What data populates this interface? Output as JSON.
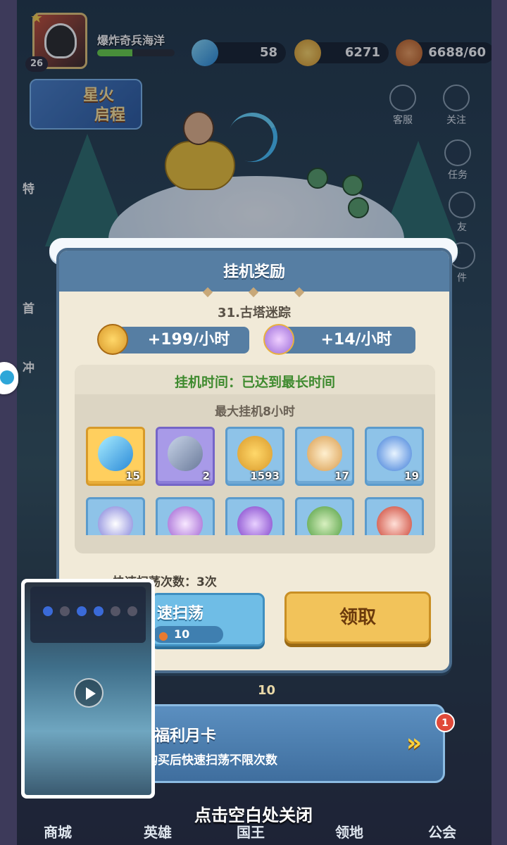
{
  "player": {
    "name": "爆炸奇兵海洋",
    "level": "26",
    "xp_fraction": 0.45
  },
  "resources": {
    "gems": "58",
    "coins": "6271",
    "stamina": "6688/60"
  },
  "event_banner": {
    "label_line1": "星火",
    "label_line2": "启程"
  },
  "side_buttons": {
    "service": "客服",
    "follow": "关注",
    "tasks": "任务",
    "friends": "友",
    "mail": "件"
  },
  "left_tabs": [
    "特",
    "首",
    "冲"
  ],
  "modal": {
    "title": "挂机奖励",
    "stage": "31.古塔迷踪",
    "coin_rate": "+199/小时",
    "orb_rate": "+14/小时",
    "idle_time": "挂机时间：已达到最长时间",
    "max_idle": "最大挂机8小时",
    "rewards": [
      {
        "icon": "diamond-icon",
        "qty": "15",
        "style": "gold"
      },
      {
        "icon": "hammer-icon",
        "qty": "2",
        "style": "purple"
      },
      {
        "icon": "coin-icon",
        "qty": "1593",
        "style": "blue"
      },
      {
        "icon": "wing-emblem-icon",
        "qty": "17",
        "style": "blue"
      },
      {
        "icon": "swirl-orb-icon",
        "qty": "19",
        "style": "blue"
      },
      {
        "icon": "paw-orb-icon",
        "qty": "",
        "style": "blue"
      },
      {
        "icon": "eye-emblem-icon",
        "qty": "",
        "style": "blue"
      },
      {
        "icon": "question-orb-icon",
        "qty": "",
        "style": "blue"
      },
      {
        "icon": "constellation-orb-icon",
        "qty": "",
        "style": "blue"
      },
      {
        "icon": "sword-orb-icon",
        "qty": "",
        "style": "blue"
      }
    ],
    "sweep_count": "快速扫荡次数：3次",
    "sweep_label": "速扫荡",
    "sweep_cost": "10",
    "claim_label": "领取"
  },
  "hidden_counter": "10",
  "monthly_card": {
    "title": "福利月卡",
    "desc": "购买后快速扫荡不限次数",
    "badge": "1"
  },
  "close_hint": "点击空白处关闭",
  "nav": [
    "商城",
    "英雄",
    "国王",
    "领地",
    "公会"
  ],
  "colors": {
    "modal_header": "#567ea3",
    "modal_body": "#f1ead8",
    "idle_time_green": "#3e8a2e",
    "claim_gold": "#f2c35a"
  }
}
